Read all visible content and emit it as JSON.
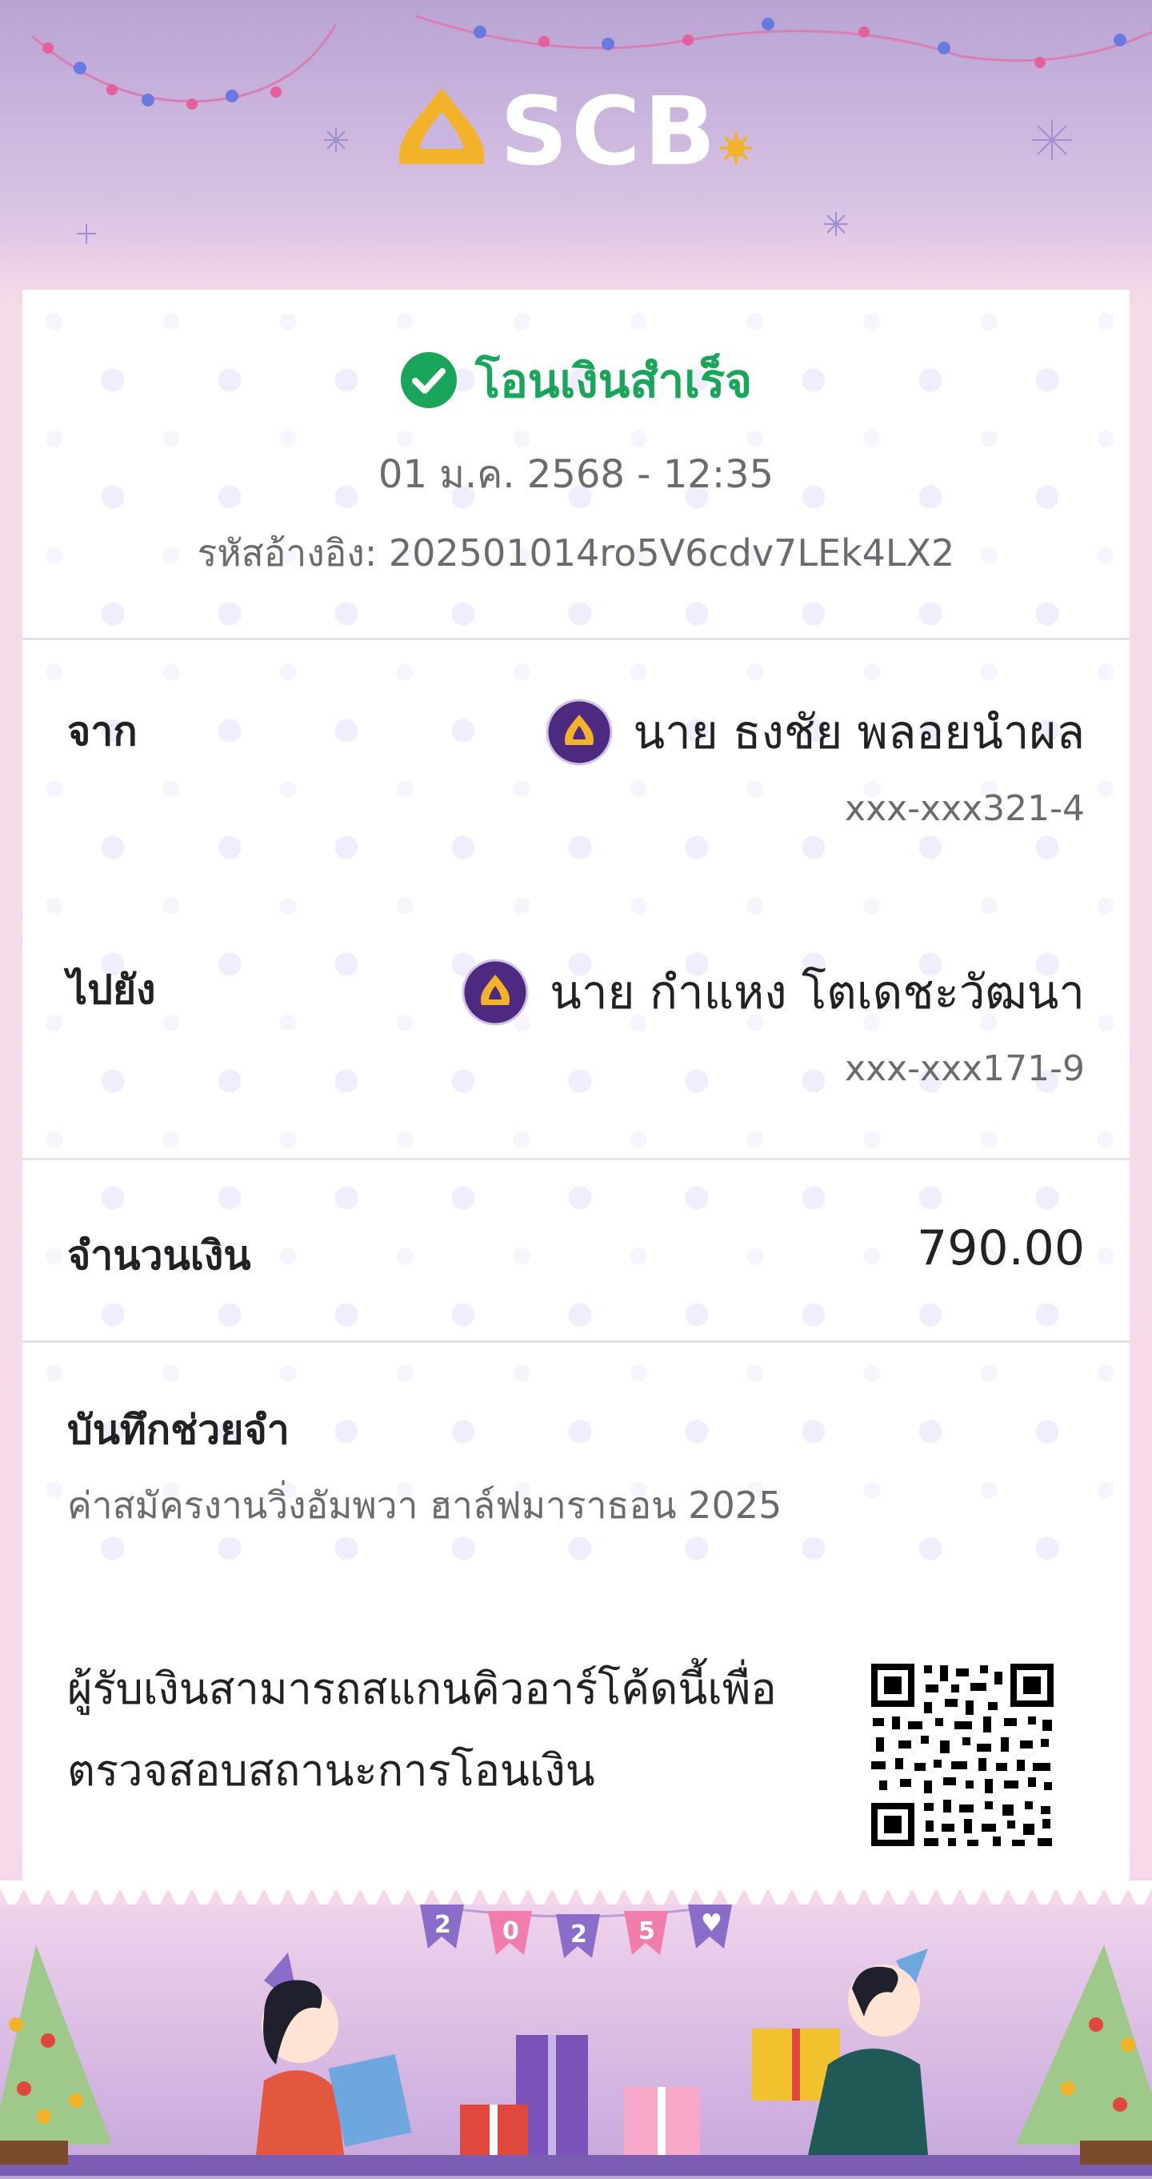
{
  "header": {
    "brand": "SCB"
  },
  "status": {
    "text": "โอนเงินสำเร็จ",
    "icon": "check-circle-icon",
    "color": "#1aa65a"
  },
  "transaction": {
    "datetime": "01 ม.ค. 2568 - 12:35",
    "reference_label": "รหัสอ้างอิง:",
    "reference": "202501014ro5V6cdv7LEk4LX2"
  },
  "from": {
    "label": "จาก",
    "name": "นาย ธงชัย พลอยนำผล",
    "account": "xxx-xxx321-4",
    "bank_icon": "scb-bank-icon"
  },
  "to": {
    "label": "ไปยัง",
    "name": "นาย กำแหง โตเดชะวัฒนา",
    "account": "xxx-xxx171-9",
    "bank_icon": "scb-bank-icon"
  },
  "amount": {
    "label": "จำนวนเงิน",
    "value": "790.00"
  },
  "memo": {
    "label": "บันทึกช่วยจำ",
    "text": "ค่าสมัครงานวิ่งอัมพวา ฮาล์ฟมาราธอน 2025"
  },
  "qr": {
    "text_line1": "ผู้รับเงินสามารถสแกนคิวอาร์โค้ดนี้เพื่อ",
    "text_line2": "ตรวจสอบสถานะการโอนเงิน"
  },
  "footer": {
    "bunting": [
      "2",
      "0",
      "2",
      "5",
      "♥"
    ]
  },
  "colors": {
    "brand_purple": "#4d2a80",
    "gold": "#f2b32a",
    "success_green": "#1aa65a"
  }
}
